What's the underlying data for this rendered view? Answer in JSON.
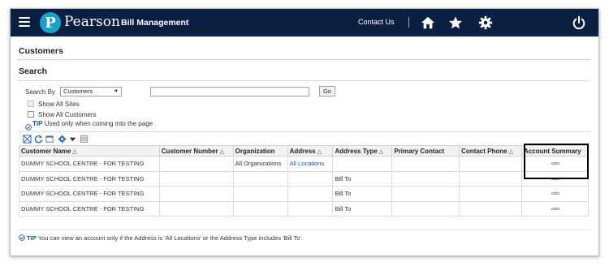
{
  "header": {
    "brand": "Pearson",
    "logo_letter": "P",
    "app_title": "Bill Management",
    "contact_label": "Contact Us",
    "icons": [
      "menu-icon",
      "home-icon",
      "star-icon",
      "gear-icon",
      "power-icon"
    ]
  },
  "page": {
    "title": "Customers",
    "search_section": "Search"
  },
  "search": {
    "search_by_label": "Search By",
    "search_by_value": "Customers",
    "search_value": "",
    "go_label": "Go",
    "show_all_sites_label": "Show All Sites",
    "show_all_customers_label": "Show All Customers",
    "tip_label": "TIP",
    "tip_text": "Used only when coming into the page"
  },
  "toolbar": {
    "icons": [
      "expand-icon",
      "refresh-icon",
      "detach-icon",
      "settings-icon",
      "dropdown-arrow-icon",
      "freeze-icon"
    ]
  },
  "table": {
    "columns": [
      "Customer Name",
      "Customer Number",
      "Organization",
      "Address",
      "Address Type",
      "Primary Contact",
      "Contact Phone",
      "Account Summary"
    ],
    "rows": [
      {
        "customer_name": "DUMMY SCHOOL CENTRE - FOR TESTING",
        "customer_number": "",
        "organization": "All Organizations",
        "address": "All Locations",
        "address_type": "",
        "primary_contact": "",
        "contact_phone": "",
        "account_summary_icon": "glasses-icon"
      },
      {
        "customer_name": "DUMMY SCHOOL CENTRE - FOR TESTING",
        "customer_number": "",
        "organization": "",
        "address": "",
        "address_type": "Bill To",
        "primary_contact": "",
        "contact_phone": "",
        "account_summary_icon": "glasses-icon"
      },
      {
        "customer_name": "DUMMY SCHOOL CENTRE - FOR TESTING",
        "customer_number": "",
        "organization": "",
        "address": "",
        "address_type": "Bill To",
        "primary_contact": "",
        "contact_phone": "",
        "account_summary_icon": "glasses-icon"
      },
      {
        "customer_name": "DUMMY SCHOOL CENTRE - FOR TESTING",
        "customer_number": "",
        "organization": "",
        "address": "",
        "address_type": "Bill To",
        "primary_contact": "",
        "contact_phone": "",
        "account_summary_icon": "glasses-icon"
      }
    ],
    "glasses_glyph": "∞∞"
  },
  "footer": {
    "tip_label": "TIP",
    "tip_text": "You can view an account only if the Address is 'All Locations' or the Address Type includes 'Bill To'."
  },
  "colors": {
    "header_bg": "#0b1f42",
    "logo_blue": "#19a1c8",
    "link_blue": "#1f4f9e"
  }
}
